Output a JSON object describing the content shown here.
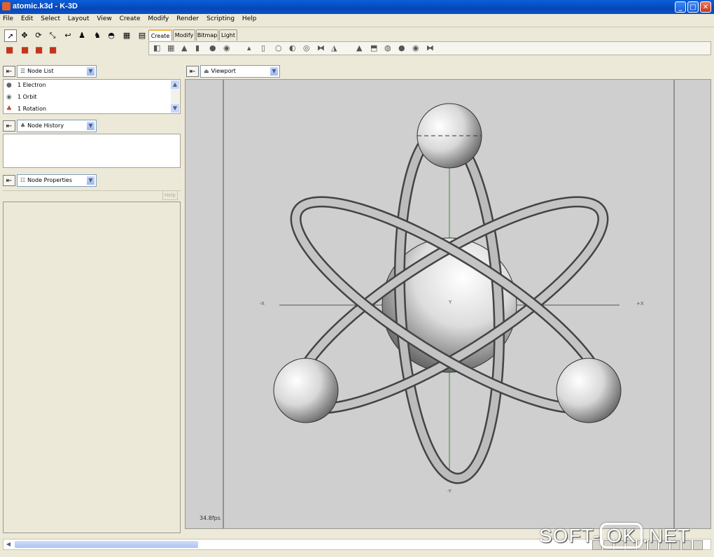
{
  "window": {
    "title": "atomic.k3d - K-3D",
    "min": "_",
    "max": "□",
    "close": "✕"
  },
  "menu": [
    "File",
    "Edit",
    "Select",
    "Layout",
    "View",
    "Create",
    "Modify",
    "Render",
    "Scripting",
    "Help"
  ],
  "tabs": [
    "Create",
    "Modify",
    "Bitmap",
    "Light"
  ],
  "panels": {
    "node_list": {
      "title": "Node List",
      "items": [
        {
          "label": "1 Electron",
          "icon": "sphere-icon"
        },
        {
          "label": "1 Orbit",
          "icon": "torus-icon"
        },
        {
          "label": "1 Rotation",
          "icon": "rotation-icon"
        }
      ]
    },
    "node_history": {
      "title": "Node History"
    },
    "node_properties": {
      "title": "Node Properties",
      "help": "Help"
    }
  },
  "viewport": {
    "title": "Viewport",
    "fps": "34.8fps",
    "axis": {
      "neg_x": "-X",
      "pos_x": "+X",
      "neg_y": "-Y",
      "y": "Y"
    }
  },
  "watermark": {
    "pre": "SOFT-",
    "box": "OK",
    "post": ".NET"
  },
  "colors": {
    "titlebar": "#0746b8",
    "panel_bg": "#ece9d8",
    "viewport_bg": "#cfcfcf",
    "tab_active": "#f2b43c"
  }
}
